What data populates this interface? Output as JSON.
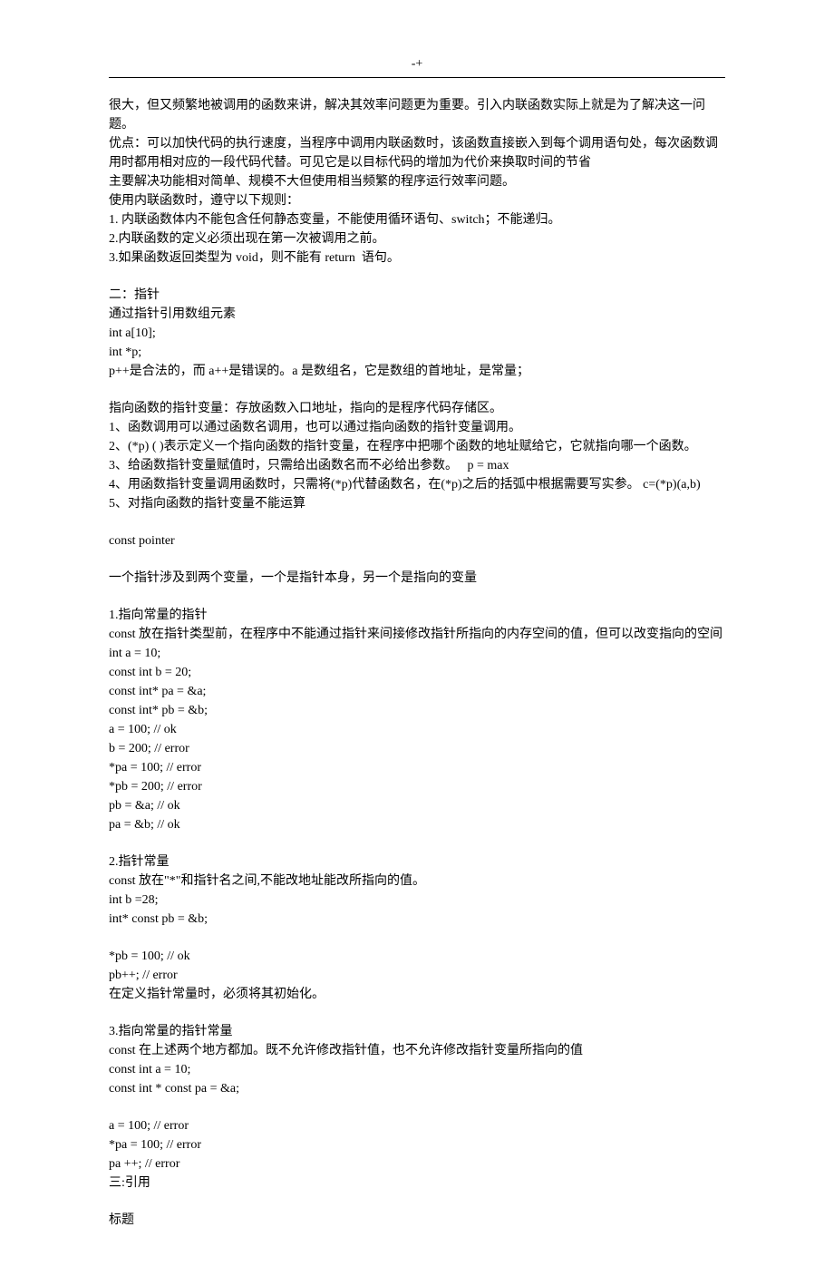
{
  "header": "-+",
  "p1": "很大，但又频繁地被调用的函数来讲，解决其效率问题更为重要。引入内联函数实际上就是为了解决这一问题。",
  "p2": "优点：可以加快代码的执行速度，当程序中调用内联函数时，该函数直接嵌入到每个调用语句处，每次函数调用时都用相对应的一段代码代替。可见它是以目标代码的增加为代价来换取时间的节省",
  "p3": "主要解决功能相对简单、规模不大但使用相当频繁的程序运行效率问题。",
  "p4": "使用内联函数时，遵守以下规则：",
  "p5": "1. 内联函数体内不能包含任何静态变量，不能使用循环语句、switch；不能递归。",
  "p6": "2.内联函数的定义必须出现在第一次被调用之前。",
  "p7": "3.如果函数返回类型为 void，则不能有 return  语句。",
  "s2_h": "二：指针",
  "s2_1": "通过指针引用数组元素",
  "s2_2": "int a[10];",
  "s2_3": "int *p;",
  "s2_4": "p++是合法的，而 a++是错误的。a 是数组名，它是数组的首地址，是常量；",
  "s2_5": "指向函数的指针变量：存放函数入口地址，指向的是程序代码存储区。",
  "s2_6": "1、函数调用可以通过函数名调用，也可以通过指向函数的指针变量调用。",
  "s2_7": "2、(*p) ( )表示定义一个指向函数的指针变量，在程序中把哪个函数的地址赋给它，它就指向哪一个函数。",
  "s2_8": "3、给函数指针变量赋值时，只需给出函数名而不必给出参数。   p = max",
  "s2_9": "4、用函数指针变量调用函数时，只需将(*p)代替函数名，在(*p)之后的括弧中根据需要写实参。 c=(*p)(a,b)",
  "s2_10": "5、对指向函数的指针变量不能运算",
  "cp": "const pointer",
  "cp1": "一个指针涉及到两个变量，一个是指针本身，另一个是指向的变量",
  "ptr1_h": "1.指向常量的指针",
  "ptr1_1": "const 放在指针类型前，在程序中不能通过指针来间接修改指针所指向的内存空间的值，但可以改变指向的空间",
  "ptr1_2": "int a = 10;",
  "ptr1_3": "const int b = 20;",
  "ptr1_4": "const int* pa = &a;",
  "ptr1_5": "const int* pb = &b;",
  "ptr1_6": "a = 100; // ok",
  "ptr1_7": "b = 200; // error",
  "ptr1_8": "*pa = 100; // error",
  "ptr1_9": "*pb = 200; // error",
  "ptr1_10": "pb = &a; // ok",
  "ptr1_11": "pa = &b; // ok",
  "ptr2_h": "2.指针常量",
  "ptr2_1": "const 放在\"*\"和指针名之间,不能改地址能改所指向的值。",
  "ptr2_2": "int b =28;",
  "ptr2_3": "int* const pb = &b;",
  "ptr2_4": "*pb = 100; // ok",
  "ptr2_5": "pb++; // error",
  "ptr2_6": "在定义指针常量时，必须将其初始化。",
  "ptr3_h": "3.指向常量的指针常量",
  "ptr3_1": "const 在上述两个地方都加。既不允许修改指针值，也不允许修改指针变量所指向的值",
  "ptr3_2": "const int a = 10;",
  "ptr3_3": "const int * const pa = &a;",
  "ptr3_4": "a = 100; // error",
  "ptr3_5": "*pa = 100; // error",
  "ptr3_6": "pa ++; // error",
  "s3_h": "三:引用",
  "footer": "标题"
}
